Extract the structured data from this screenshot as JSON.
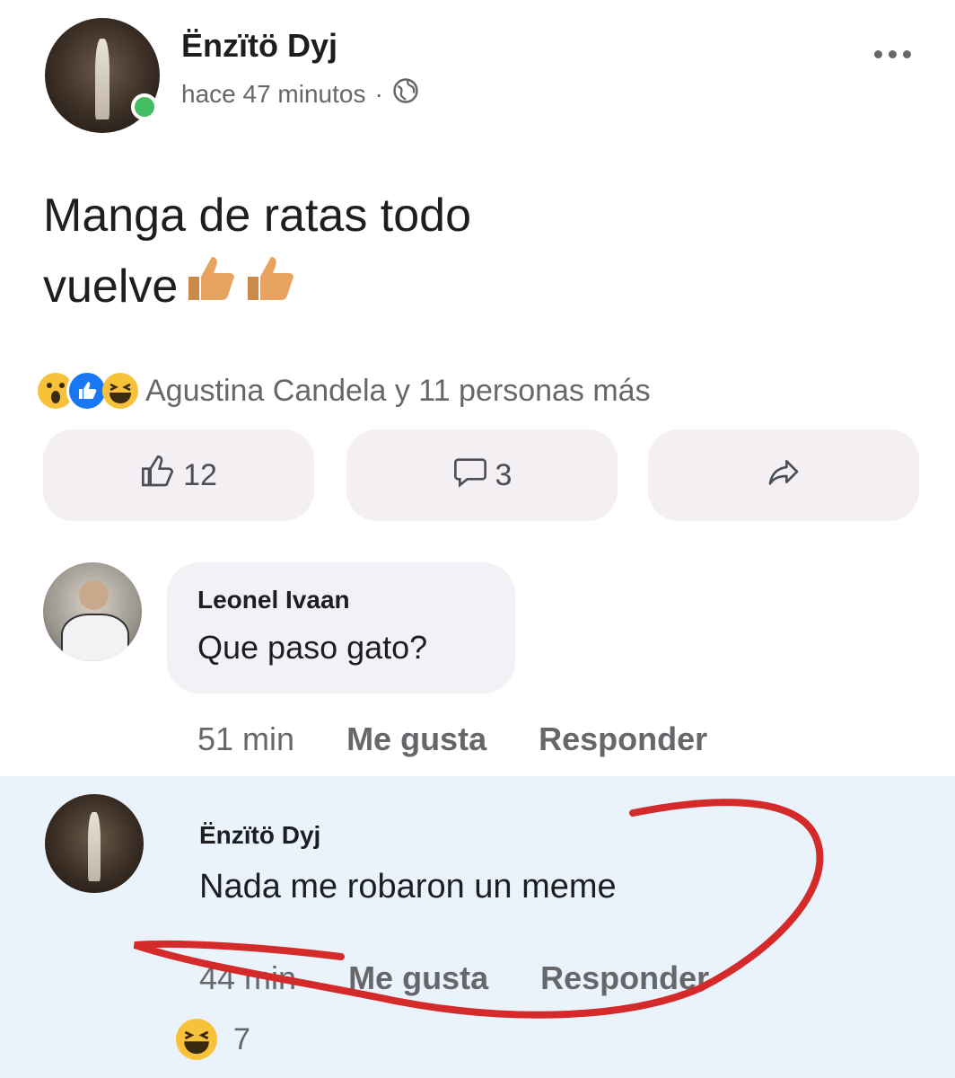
{
  "post": {
    "author": "Ënzïtö Dyj",
    "time": "hace 47 minutos",
    "separator": "·",
    "text_line1": "Manga de ratas todo",
    "text_line2": "vuelve",
    "reactions_summary": "Agustina Candela y 11 personas más",
    "like_count": "12",
    "comment_count": "3",
    "more_icon": "more-dots-icon",
    "privacy_icon": "globe-icon"
  },
  "comments": [
    {
      "author": "Leonel Ivaan",
      "text": "Que paso gato?",
      "time": "51 min",
      "like_label": "Me gusta",
      "reply_label": "Responder"
    },
    {
      "author": "Ënzïtö Dyj",
      "text": "Nada me robaron un meme",
      "time": "44 min",
      "like_label": "Me gusta",
      "reply_label": "Responder",
      "reaction_count": "7"
    }
  ],
  "colors": {
    "online": "#45bd62",
    "annotation": "#d42a2a",
    "highlight": "#eaf3fb",
    "like_blue": "#1877f2"
  }
}
